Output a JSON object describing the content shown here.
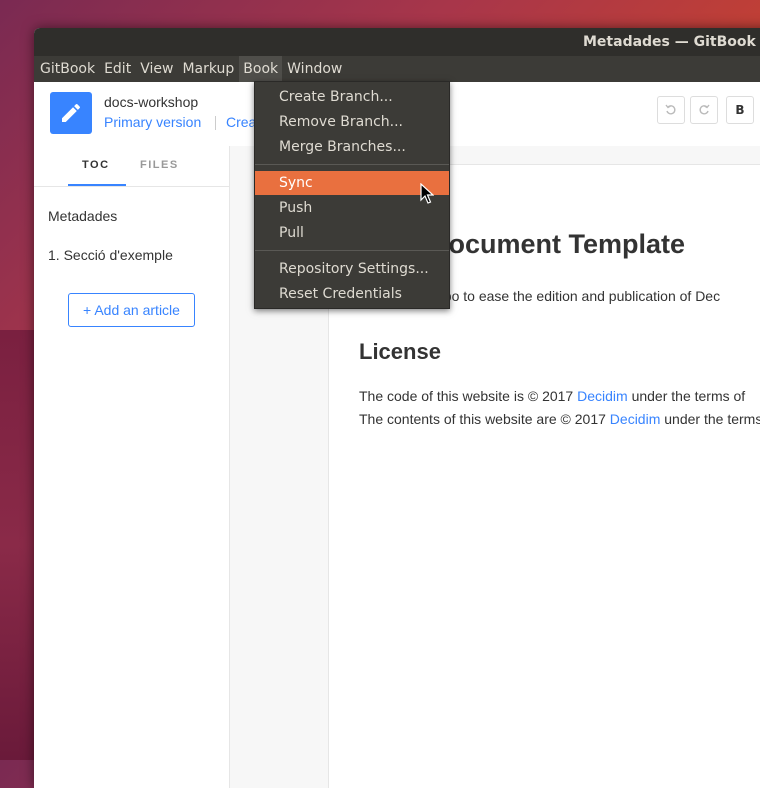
{
  "window": {
    "title": "Metadades — GitBook Editor"
  },
  "menubar": [
    "GitBook",
    "Edit",
    "View",
    "Markup",
    "Book",
    "Window"
  ],
  "header": {
    "repo_name": "docs-workshop",
    "version": "Primary version",
    "create_link": "Crea",
    "bold_label": "B"
  },
  "sidebar": {
    "tabs": [
      "TOC",
      "FILES"
    ],
    "items": [
      "Metadades",
      "1. Secció d'exemple"
    ],
    "add_article": "+ Add an article"
  },
  "document": {
    "title": "n Document Template",
    "paragraph": "er repo to ease the edition and publication of Dec",
    "license_heading": "License",
    "license_line1_pre": "The code of this website is © 2017 ",
    "license_line1_link": "Decidim",
    "license_line1_post": " under the terms of",
    "license_line2_pre": "The contents of this website are © 2017 ",
    "license_line2_link": "Decidim",
    "license_line2_post": " under the terms"
  },
  "book_menu": {
    "group1": [
      "Create Branch...",
      "Remove Branch...",
      "Merge Branches..."
    ],
    "group2": [
      "Sync",
      "Push",
      "Pull"
    ],
    "group3": [
      "Repository Settings...",
      "Reset Credentials"
    ],
    "hovered": "Sync"
  },
  "colors": {
    "accent": "#3884ff",
    "menu_hover": "#e9703f",
    "menu_bg": "#3c3b37"
  },
  "icons": {
    "logo": "pencil-icon",
    "undo": "undo-icon",
    "redo": "redo-icon"
  }
}
